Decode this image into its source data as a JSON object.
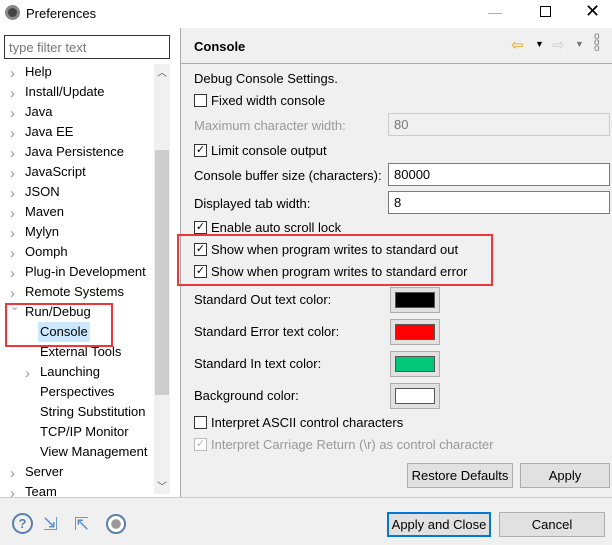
{
  "window": {
    "title": "Preferences",
    "icon": "eclipse-gear-icon"
  },
  "filter": {
    "placeholder": "type filter text"
  },
  "tree": [
    {
      "label": "Help",
      "expand": "collapsed"
    },
    {
      "label": "Install/Update",
      "expand": "collapsed"
    },
    {
      "label": "Java",
      "expand": "collapsed"
    },
    {
      "label": "Java EE",
      "expand": "collapsed"
    },
    {
      "label": "Java Persistence",
      "expand": "collapsed"
    },
    {
      "label": "JavaScript",
      "expand": "collapsed"
    },
    {
      "label": "JSON",
      "expand": "collapsed"
    },
    {
      "label": "Maven",
      "expand": "collapsed"
    },
    {
      "label": "Mylyn",
      "expand": "collapsed"
    },
    {
      "label": "Oomph",
      "expand": "collapsed"
    },
    {
      "label": "Plug-in Development",
      "expand": "collapsed"
    },
    {
      "label": "Remote Systems",
      "expand": "collapsed"
    },
    {
      "label": "Run/Debug",
      "expand": "expanded"
    },
    {
      "label": "Console",
      "child": true,
      "selected": true
    },
    {
      "label": "External Tools",
      "child": true
    },
    {
      "label": "Launching",
      "child": true,
      "expand": "collapsed"
    },
    {
      "label": "Perspectives",
      "child": true
    },
    {
      "label": "String Substitution",
      "child": true
    },
    {
      "label": "TCP/IP Monitor",
      "child": true
    },
    {
      "label": "View Management",
      "child": true
    },
    {
      "label": "Server",
      "expand": "collapsed"
    },
    {
      "label": "Team",
      "expand": "collapsed"
    }
  ],
  "page": {
    "title": "Console",
    "section": "Debug Console Settings.",
    "fixed_width": {
      "label": "Fixed width console",
      "checked": false
    },
    "max_width": {
      "label": "Maximum character width:",
      "value": "80",
      "disabled": true
    },
    "limit_output": {
      "label": "Limit console output",
      "checked": true
    },
    "buffer_size": {
      "label": "Console buffer size (characters):",
      "value": "80000"
    },
    "tab_width": {
      "label": "Displayed tab width:",
      "value": "8"
    },
    "auto_scroll": {
      "label": "Enable auto scroll lock",
      "checked": true
    },
    "show_out": {
      "label": "Show when program writes to standard out",
      "checked": true
    },
    "show_err": {
      "label": "Show when program writes to standard error",
      "checked": true
    },
    "out_color": {
      "label": "Standard Out text color:",
      "color": "#000000"
    },
    "err_color": {
      "label": "Standard Error text color:",
      "color": "#ff0000"
    },
    "in_color": {
      "label": "Standard In text color:",
      "color": "#00c878"
    },
    "bg_color": {
      "label": "Background color:",
      "color": "#ffffff"
    },
    "ascii": {
      "label": "Interpret ASCII control characters",
      "checked": false
    },
    "cr": {
      "label": "Interpret Carriage Return (\\r) as control character",
      "checked": true,
      "disabled": true
    },
    "restore_defaults": "Restore Defaults",
    "apply": "Apply"
  },
  "footer": {
    "apply_close": "Apply and Close",
    "cancel": "Cancel"
  },
  "highlight_color": "#e8383d"
}
